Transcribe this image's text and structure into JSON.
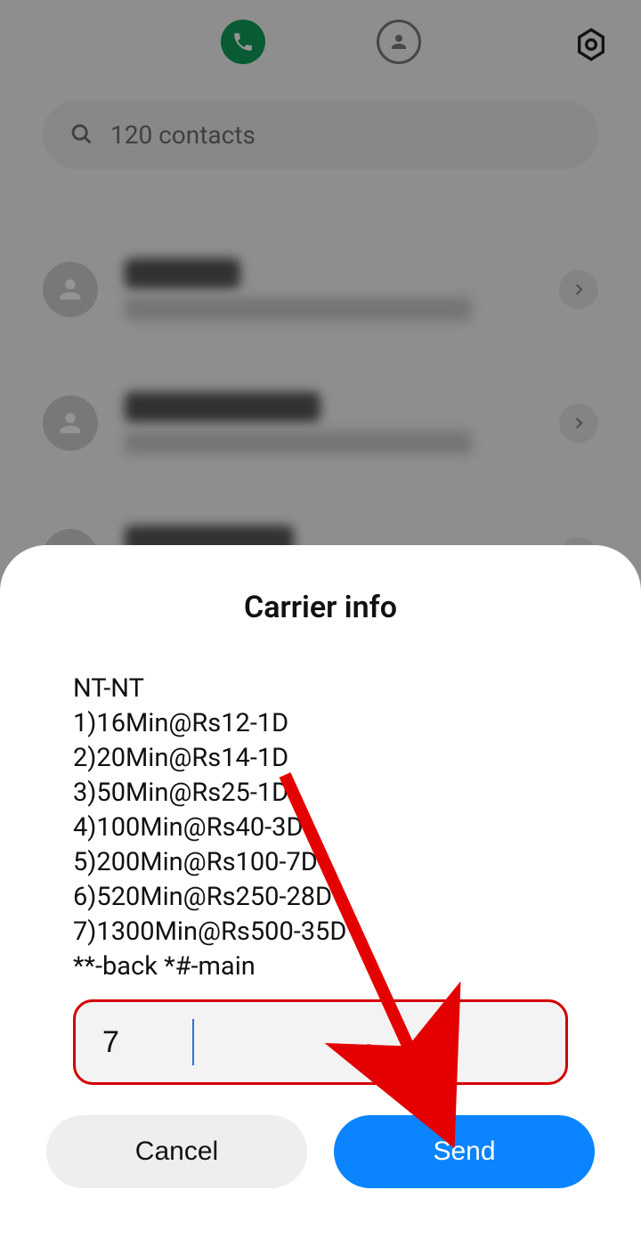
{
  "search": {
    "placeholder": "120 contacts"
  },
  "dialog": {
    "title": "Carrier info",
    "body_lines": [
      "NT-NT",
      "1)16Min@Rs12-1D",
      "2)20Min@Rs14-1D",
      "3)50Min@Rs25-1D",
      "4)100Min@Rs40-3D",
      "5)200Min@Rs100-7D",
      "6)520Min@Rs250-28D",
      "7)1300Min@Rs500-35D",
      " **-back *#-main"
    ],
    "input_value": "7",
    "cancel_label": "Cancel",
    "send_label": "Send"
  },
  "colors": {
    "accent": "#0a84ff",
    "annotation": "#d40000",
    "call_tab": "#0f9d58"
  }
}
